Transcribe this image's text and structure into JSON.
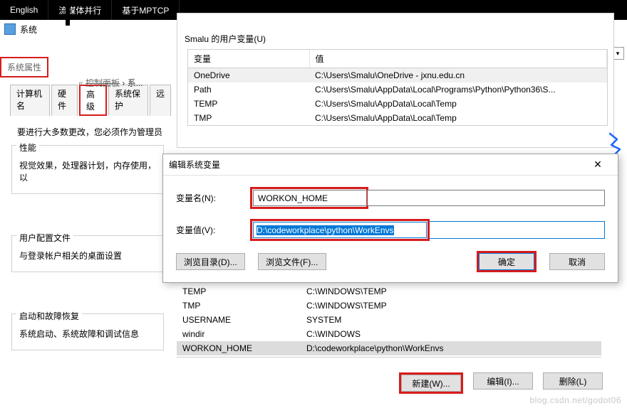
{
  "topbar": {
    "tabs": [
      "English",
      "流媒体并行",
      "基于MPTCP"
    ]
  },
  "system_window": {
    "title": "系统"
  },
  "breadcrumb": {
    "text": "控制面板",
    "next": "系..."
  },
  "sysprops": {
    "title": "系统属性",
    "tabs": {
      "computer_name": "计算机名",
      "hardware": "硬件",
      "advanced": "高级",
      "protection": "系统保护",
      "remote": "远"
    },
    "admin_note": "要进行大多数更改，您必须作为管理员",
    "perf": {
      "legend": "性能",
      "desc": "视觉效果，处理器计划，内存使用，以"
    },
    "profiles": {
      "legend": "用户配置文件",
      "desc": "与登录帐户相关的桌面设置"
    },
    "startup": {
      "legend": "启动和故障恢复",
      "desc": "系统启动、系统故障和调试信息"
    }
  },
  "env_upper": {
    "caption": "Smalu 的用户变量(U)",
    "columns": {
      "var": "变量",
      "val": "值"
    },
    "rows": [
      {
        "var": "OneDrive",
        "val": "C:\\Users\\Smalu\\OneDrive - jxnu.edu.cn"
      },
      {
        "var": "Path",
        "val": "C:\\Users\\Smalu\\AppData\\Local\\Programs\\Python\\Python36\\S..."
      },
      {
        "var": "TEMP",
        "val": "C:\\Users\\Smalu\\AppData\\Local\\Temp"
      },
      {
        "var": "TMP",
        "val": "C:\\Users\\Smalu\\AppData\\Local\\Temp"
      }
    ]
  },
  "edit_dialog": {
    "title": "编辑系统变量",
    "name_label": "变量名(N):",
    "name_value": "WORKON_HOME",
    "value_label": "变量值(V):",
    "value_value": "D:\\codeworkplace\\python\\WorkEnvs",
    "browse_dir": "浏览目录(D)...",
    "browse_file": "浏览文件(F)...",
    "ok": "确定",
    "cancel": "取消"
  },
  "env_lower": {
    "rows": [
      {
        "var": "TEMP",
        "val": "C:\\WINDOWS\\TEMP"
      },
      {
        "var": "TMP",
        "val": "C:\\WINDOWS\\TEMP"
      },
      {
        "var": "USERNAME",
        "val": "SYSTEM"
      },
      {
        "var": "windir",
        "val": "C:\\WINDOWS"
      },
      {
        "var": "WORKON_HOME",
        "val": "D:\\codeworkplace\\python\\WorkEnvs"
      }
    ],
    "buttons": {
      "new": "新建(W)...",
      "edit": "编辑(I)...",
      "del": "删除(L)"
    }
  },
  "watermark": "blog.csdn.net/godot06"
}
